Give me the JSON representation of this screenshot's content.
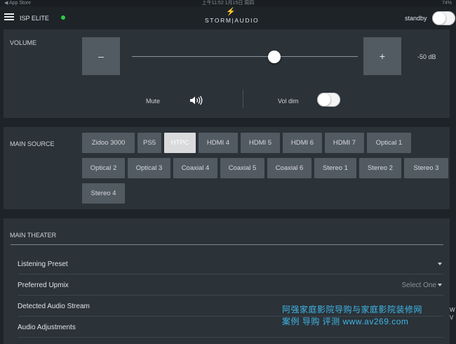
{
  "status_bar": {
    "left": "◀ App Store",
    "center": "上午11:52   1月15日 周四",
    "right": "74%"
  },
  "header": {
    "device_name": "ISP ELITE",
    "logo_text": "STORM|AUDIO",
    "standby_label": "standby",
    "status_color": "#2ecc40"
  },
  "volume": {
    "label": "VOLUME",
    "minus_label": "–",
    "plus_label": "+",
    "value_text": "-50 dB",
    "slider_fraction": 0.63,
    "mute_label": "Mute",
    "vol_dim_label": "Vol dim"
  },
  "main_source": {
    "label": "MAIN SOURCE",
    "selected": "HTPC",
    "rows": [
      [
        "Zidoo 3000",
        "PS5",
        "HTPC",
        "HDMI 4",
        "HDMI 5",
        "HDMI 6",
        "HDMI 7",
        "Optical 1"
      ],
      [
        "Optical 2",
        "Optical 3",
        "Coaxial 4",
        "Coaxial 5",
        "Coaxial 6",
        "Stereo 1",
        "Stereo 2",
        "Stereo 3"
      ],
      [
        "Stereo 4"
      ]
    ]
  },
  "main_theater": {
    "label": "MAIN THEATER",
    "rows": [
      {
        "label": "Listening Preset",
        "right": ""
      },
      {
        "label": "Preferred Upmix",
        "right": "Select One"
      },
      {
        "label": "Detected Audio Stream",
        "right": ""
      },
      {
        "label": "Audio Adjustments",
        "right": ""
      }
    ]
  },
  "watermark": {
    "line1": "阿强家庭影院导购与家庭影院装修网",
    "line2": "案例  导购  评测  www.av269.com"
  },
  "edge_chars": [
    "W",
    "V"
  ]
}
